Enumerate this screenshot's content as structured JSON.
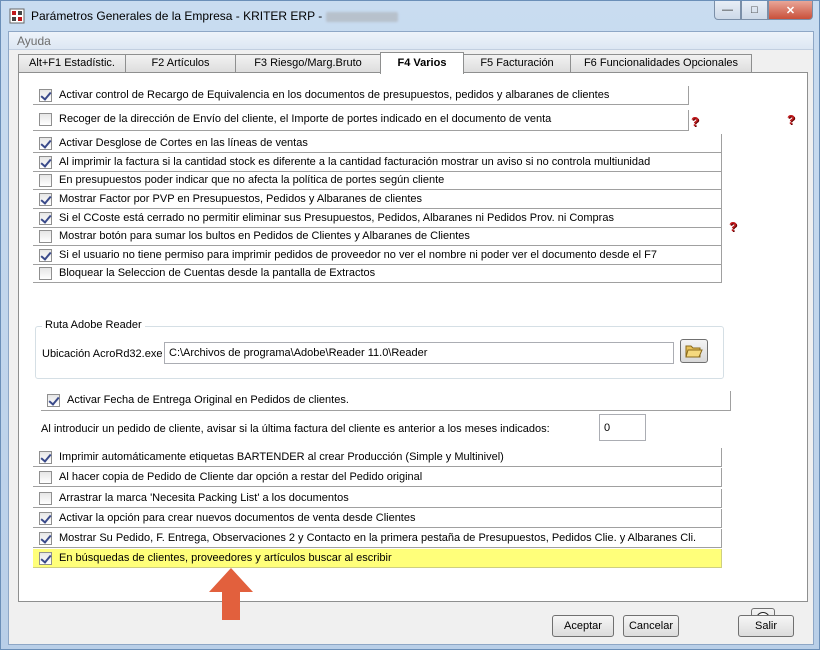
{
  "window": {
    "title": "Parámetros Generales de la Empresa - KRITER ERP -",
    "controls": {
      "minimize": "—",
      "maximize": "□",
      "close": "✕"
    }
  },
  "menu": {
    "items": [
      "Ayuda"
    ]
  },
  "tabs": [
    {
      "label": "Alt+F1 Estadístic.",
      "active": false
    },
    {
      "label": "F2 Artículos",
      "active": false
    },
    {
      "label": "F3 Riesgo/Marg.Bruto",
      "active": false
    },
    {
      "label": "F4 Varios",
      "active": true
    },
    {
      "label": "F5 Facturación",
      "active": false
    },
    {
      "label": "F6 Funcionalidades Opcionales",
      "active": false
    }
  ],
  "options": [
    {
      "label": "Activar control de Recargo de Equivalencia en los documentos de presupuestos, pedidos y albaranes de clientes",
      "checked": true
    },
    {
      "label": "Recoger de la dirección de Envío del cliente, el Importe de portes indicado en el documento de venta",
      "checked": false
    },
    {
      "label": "Activar Desglose de Cortes en las líneas de ventas",
      "checked": true
    },
    {
      "label": "Al imprimir la factura si la cantidad stock es diferente a la cantidad facturación mostrar un aviso si no controla multiunidad",
      "checked": true
    },
    {
      "label": "En presupuestos poder indicar que no afecta la política de portes según cliente",
      "checked": false
    },
    {
      "label": "Mostrar Factor por PVP en Presupuestos, Pedidos y Albaranes de clientes",
      "checked": true
    },
    {
      "label": "Si el CCoste está cerrado no permitir eliminar sus Presupuestos, Pedidos, Albaranes ni Pedidos Prov. ni Compras",
      "checked": true
    },
    {
      "label": "Mostrar botón para sumar los bultos en Pedidos de Clientes y Albaranes de Clientes",
      "checked": false
    },
    {
      "label": "Si el usuario no tiene permiso para imprimir pedidos de proveedor no ver el nombre ni poder ver el documento desde el F7",
      "checked": true
    },
    {
      "label": "Bloquear la Seleccion de Cuentas desde la pantalla de Extractos",
      "checked": false
    },
    {
      "label": "Activar Fecha de Entrega Original en Pedidos de clientes.",
      "checked": true
    },
    {
      "label": "Imprimir automáticamente etiquetas BARTENDER al crear Producción (Simple y Multinivel)",
      "checked": true
    },
    {
      "label": "Al hacer copia de Pedido de Cliente dar opción a restar del Pedido original",
      "checked": false
    },
    {
      "label": "Arrastrar la marca 'Necesita Packing List' a los documentos",
      "checked": false
    },
    {
      "label": "Activar la opción para crear nuevos documentos de venta desde Clientes",
      "checked": true
    },
    {
      "label": "Mostrar Su Pedido, F. Entrega, Observaciones 2 y Contacto en la primera pestaña de Presupuestos, Pedidos Clie. y Albaranes Cli.",
      "checked": true
    },
    {
      "label": "En búsquedas de clientes, proveedores y artículos buscar al escribir",
      "checked": true
    }
  ],
  "adobe": {
    "group_title": "Ruta Adobe Reader",
    "label": "Ubicación AcroRd32.exe",
    "value": "C:\\Archivos de programa\\Adobe\\Reader 11.0\\Reader"
  },
  "months_check": {
    "label": "Al introducir un pedido de cliente, avisar si la última factura del cliente es anterior a los meses indicados:",
    "value": "0"
  },
  "buttons": {
    "accept": "Aceptar",
    "cancel": "Cancelar",
    "exit": "Salir"
  },
  "icons": {
    "help": "red-question-icon",
    "folder": "folder-open-icon",
    "back": "back-arrow-icon",
    "annotation": "orange-arrow-up"
  },
  "colors": {
    "highlight": "#ffff7a",
    "annotation_arrow": "#e2603d",
    "help_icon": "#c0181b"
  }
}
